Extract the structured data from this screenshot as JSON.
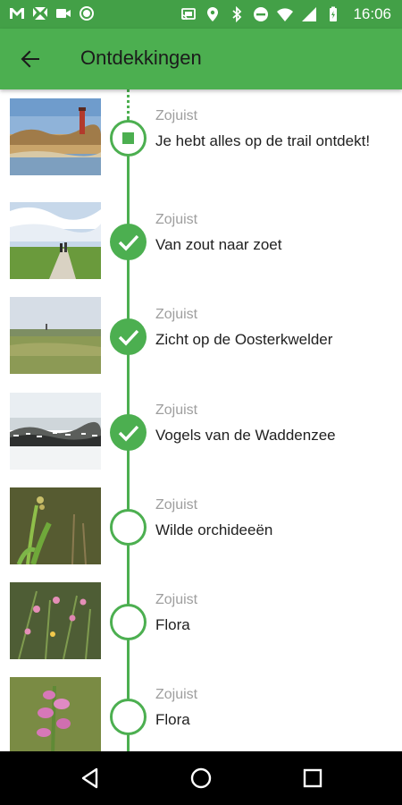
{
  "status_bar": {
    "time": "16:06",
    "left_icons": [
      "gmail-icon",
      "photos-icon",
      "video-icon",
      "circle-icon"
    ],
    "right_icons": [
      "cast-icon",
      "location-icon",
      "bluetooth-icon",
      "do-not-disturb-icon",
      "wifi-icon",
      "signal-icon",
      "battery-icon"
    ]
  },
  "app_bar": {
    "title": "Ontdekkingen",
    "back_icon": "arrow-back-icon"
  },
  "colors": {
    "primary": "#4caf50",
    "status_bar": "#43a047",
    "text": "#212121",
    "secondary_text": "#9e9e9e"
  },
  "items": [
    {
      "time": "Zojuist",
      "title": "Je hebt alles op de trail ontdekt!",
      "state": "current",
      "thumb": "lighthouse-dunes"
    },
    {
      "time": "Zojuist",
      "title": "Van zout naar zoet",
      "state": "checked",
      "thumb": "path-walkers"
    },
    {
      "time": "Zojuist",
      "title": "Zicht op de Oosterkwelder",
      "state": "checked",
      "thumb": "salt-marsh"
    },
    {
      "time": "Zojuist",
      "title": "Vogels van de Waddenzee",
      "state": "checked",
      "thumb": "bird-flock"
    },
    {
      "time": "Zojuist",
      "title": "Wilde orchideeën",
      "state": "open",
      "thumb": "orchid"
    },
    {
      "time": "Zojuist",
      "title": "Flora",
      "state": "open",
      "thumb": "pink-flowers"
    },
    {
      "time": "Zojuist",
      "title": "Flora",
      "state": "open",
      "thumb": "snapdragon"
    }
  ],
  "nav_bar": {
    "buttons": [
      "back-triangle-icon",
      "home-circle-icon",
      "recents-square-icon"
    ]
  }
}
